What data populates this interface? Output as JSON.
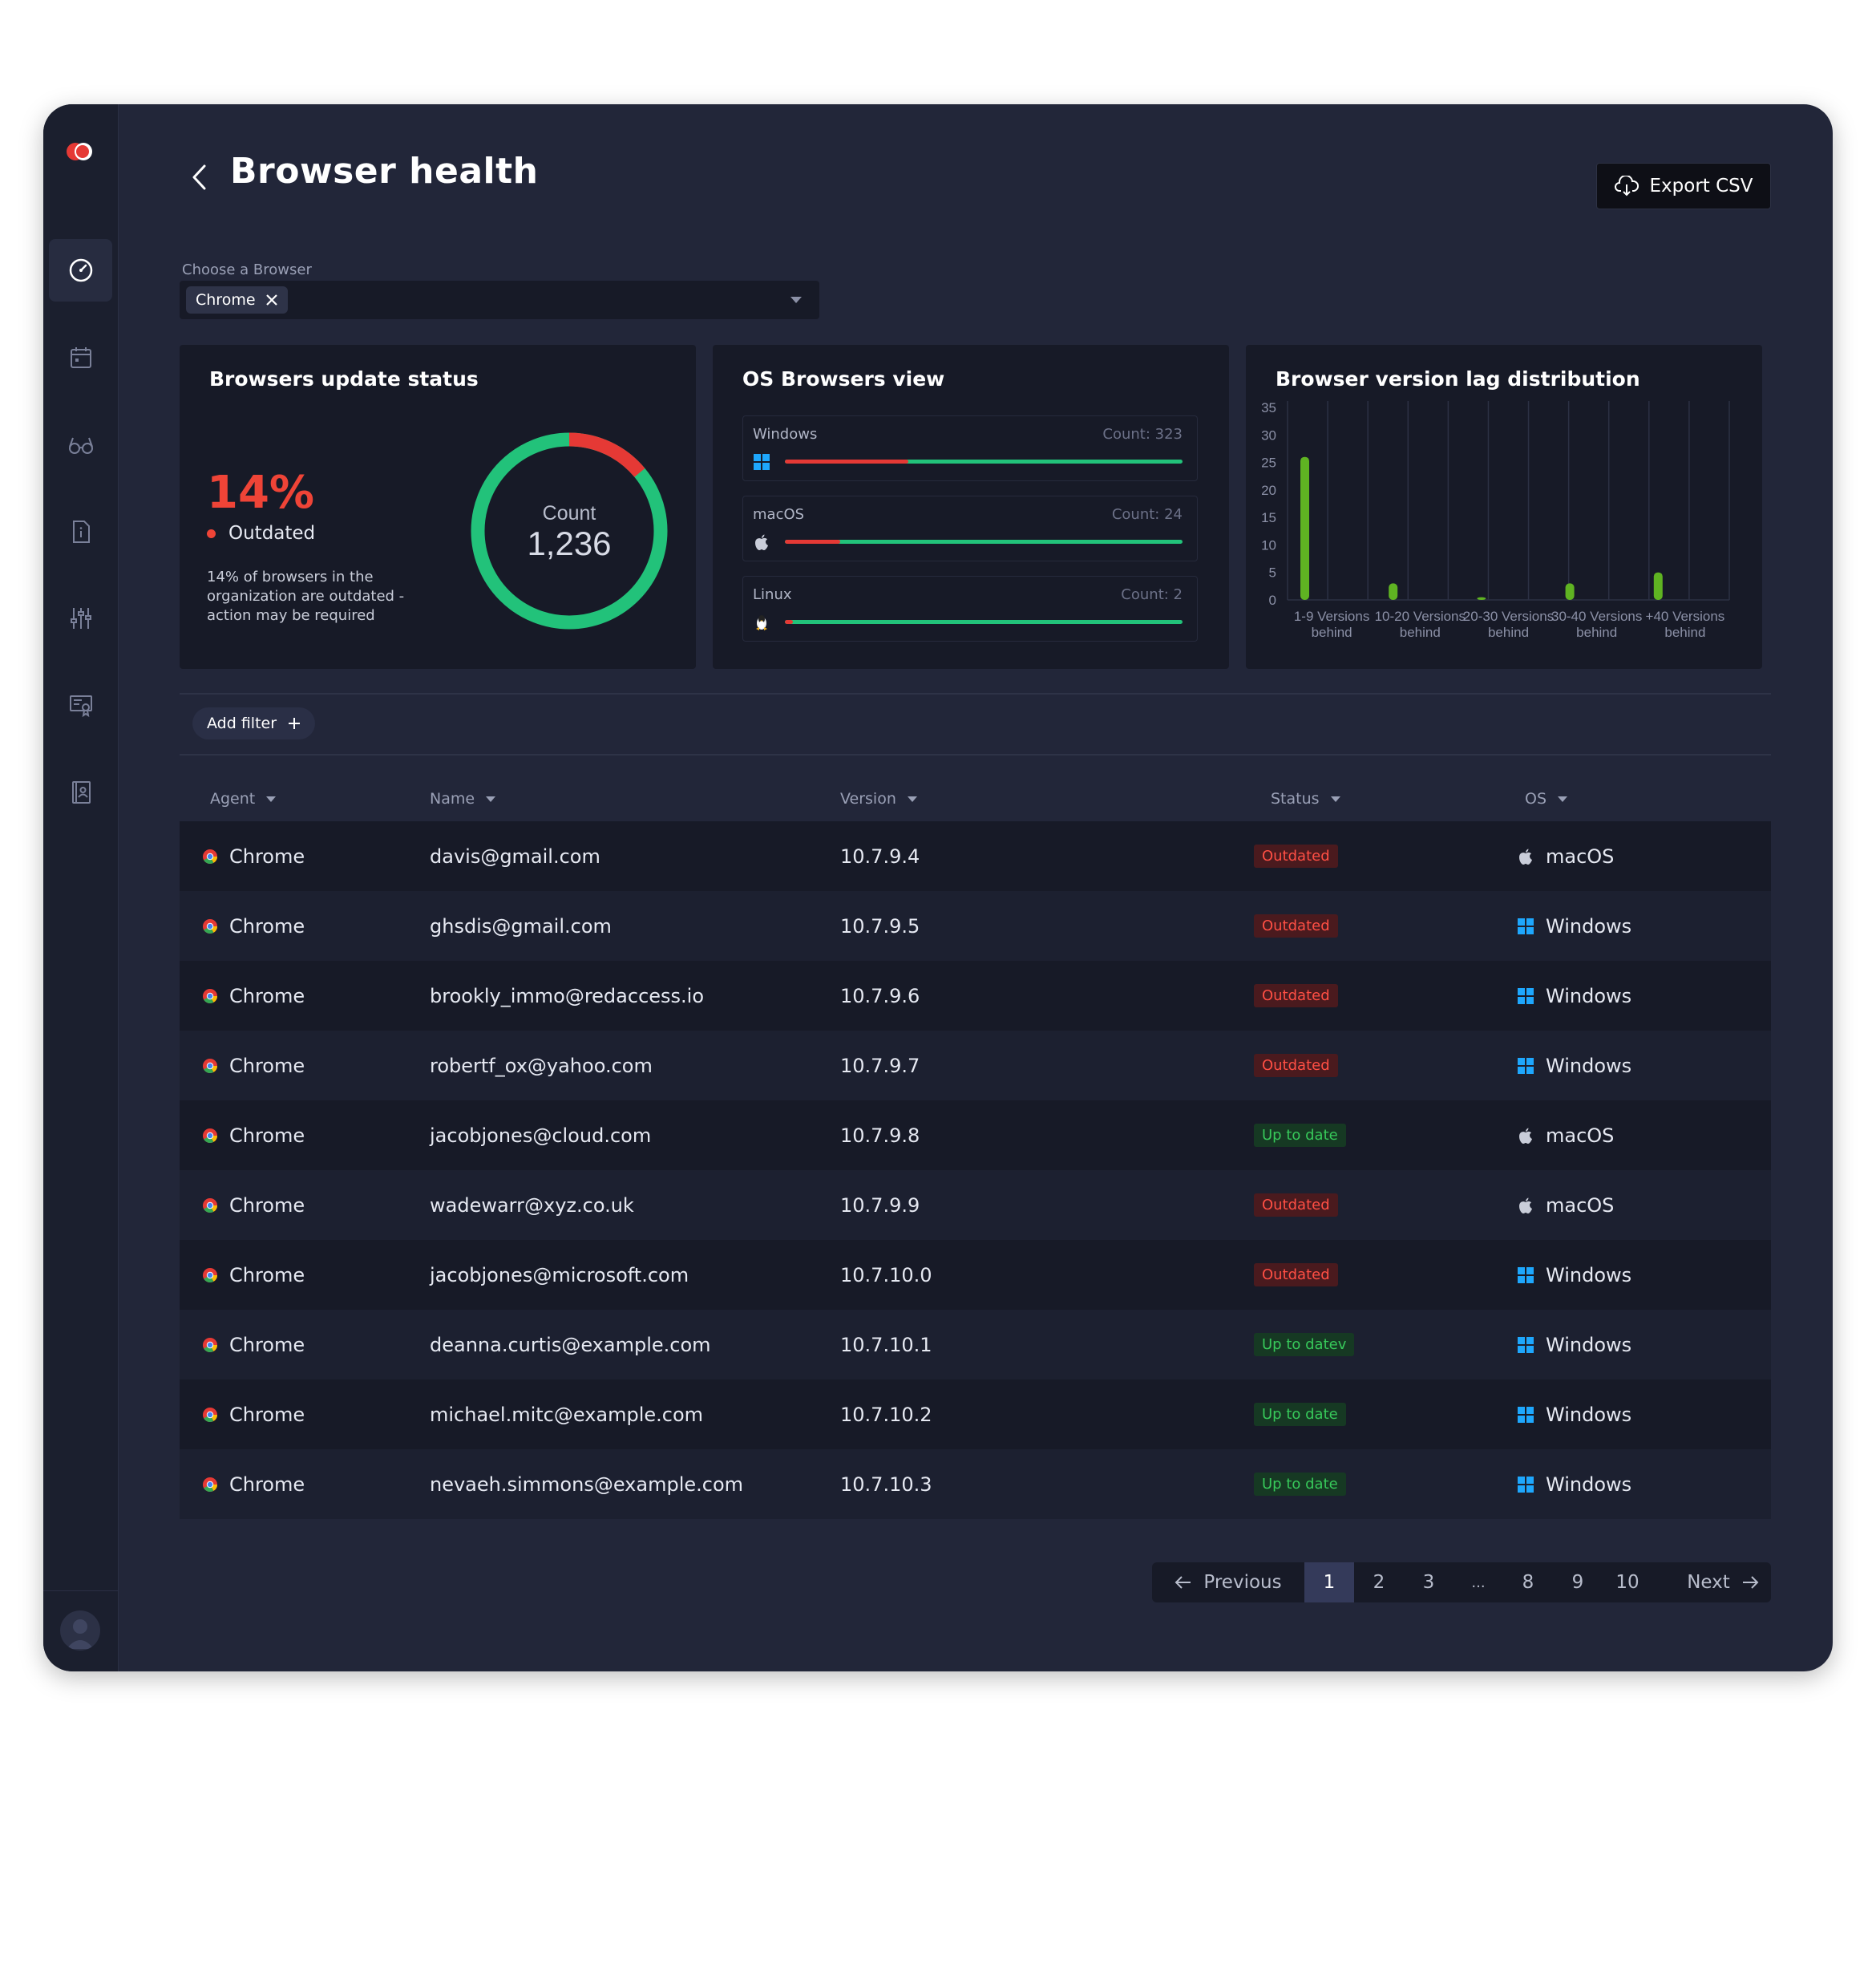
{
  "header": {
    "title": "Browser health",
    "export_label": "Export CSV"
  },
  "browser_select": {
    "label": "Choose a Browser",
    "selected": "Chrome"
  },
  "update_status": {
    "title": "Browsers update status",
    "percent": "14%",
    "status_label": "Outdated",
    "description": "14% of browsers in the organization are outdated - action may be required",
    "count_label": "Count",
    "count": "1,236",
    "outdated_fraction": 0.14,
    "colors": {
      "outdated": "#e53935",
      "up_to_date": "#22c27a"
    }
  },
  "os_view": {
    "title": "OS Browsers view",
    "rows": [
      {
        "name": "Windows",
        "count": "Count: 323",
        "outdated_fraction": 0.31,
        "icon": "windows-icon"
      },
      {
        "name": "macOS",
        "count": "Count: 24",
        "outdated_fraction": 0.14,
        "icon": "apple-icon"
      },
      {
        "name": "Linux",
        "count": "Count: 2",
        "outdated_fraction": 0.02,
        "icon": "linux-icon"
      }
    ]
  },
  "chart_data": {
    "type": "bar",
    "title": "Browser version lag distribution",
    "categories": [
      "1-9 Versions behind",
      "10-20 Versions behind",
      "20-30 Versions behind",
      "30-40 Versions behind",
      "+40 Versions behind"
    ],
    "values": [
      26,
      3,
      0.5,
      3,
      5
    ],
    "ylim": [
      0,
      35
    ],
    "yticks": [
      0,
      5,
      10,
      15,
      20,
      25,
      30,
      35
    ],
    "grid": true,
    "color": "#5fb322"
  },
  "filter": {
    "add_label": "Add filter"
  },
  "table": {
    "columns": [
      "Agent",
      "Name",
      "Version",
      "Status",
      "OS"
    ],
    "rows": [
      {
        "agent": "Chrome",
        "name": "davis@gmail.com",
        "version": "10.7.9.4",
        "status": "Outdated",
        "state": "out",
        "os": "macOS"
      },
      {
        "agent": "Chrome",
        "name": "ghsdis@gmail.com",
        "version": "10.7.9.5",
        "status": "Outdated",
        "state": "out",
        "os": "Windows"
      },
      {
        "agent": "Chrome",
        "name": "brookly_immo@redaccess.io",
        "version": "10.7.9.6",
        "status": "Outdated",
        "state": "out",
        "os": "Windows"
      },
      {
        "agent": "Chrome",
        "name": "robertf_ox@yahoo.com",
        "version": "10.7.9.7",
        "status": "Outdated",
        "state": "out",
        "os": "Windows"
      },
      {
        "agent": "Chrome",
        "name": "jacobjones@cloud.com",
        "version": "10.7.9.8",
        "status": "Up to date",
        "state": "ok",
        "os": "macOS"
      },
      {
        "agent": "Chrome",
        "name": "wadewarr@xyz.co.uk",
        "version": "10.7.9.9",
        "status": "Outdated",
        "state": "out",
        "os": "macOS"
      },
      {
        "agent": "Chrome",
        "name": "jacobjones@microsoft.com",
        "version": "10.7.10.0",
        "status": "Outdated",
        "state": "out",
        "os": "Windows"
      },
      {
        "agent": "Chrome",
        "name": "deanna.curtis@example.com",
        "version": "10.7.10.1",
        "status": "Up to datev",
        "state": "ok",
        "os": "Windows"
      },
      {
        "agent": "Chrome",
        "name": "michael.mitc@example.com",
        "version": "10.7.10.2",
        "status": "Up to date",
        "state": "ok",
        "os": "Windows"
      },
      {
        "agent": "Chrome",
        "name": "nevaeh.simmons@example.com",
        "version": "10.7.10.3",
        "status": "Up to date",
        "state": "ok",
        "os": "Windows"
      }
    ]
  },
  "pagination": {
    "previous": "Previous",
    "next": "Next",
    "pages": [
      "1",
      "2",
      "3",
      "...",
      "8",
      "9",
      "10"
    ],
    "current": "1"
  },
  "sidebar": {
    "icons": [
      "dashboard-icon",
      "calendar-icon",
      "glasses-icon",
      "document-info-icon",
      "sliders-icon",
      "certificate-icon",
      "contacts-book-icon"
    ]
  }
}
